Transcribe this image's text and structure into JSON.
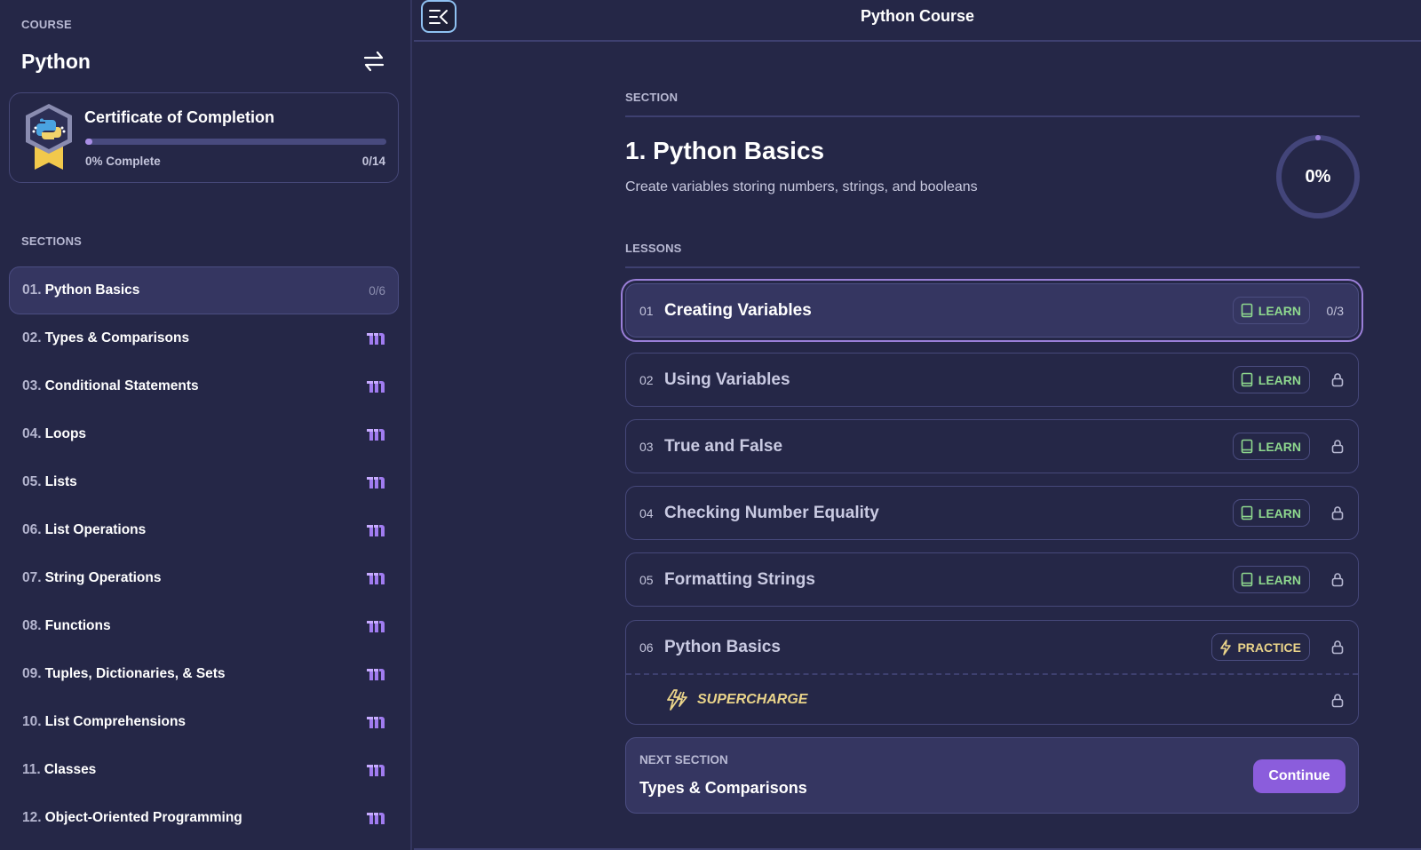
{
  "sidebar": {
    "course_label": "COURSE",
    "course_title": "Python",
    "swap_icon": "swap-arrows-icon",
    "certificate": {
      "title": "Certificate of Completion",
      "progress_percent": 0,
      "progress_text": "0% Complete",
      "count": "0/14",
      "badge_icon": "python-badge-icon"
    },
    "sections_label": "SECTIONS",
    "sections": [
      {
        "num": "01.",
        "name": "Python Basics",
        "count": "0/6",
        "active": true
      },
      {
        "num": "02.",
        "name": "Types & Comparisons",
        "icon": "m-logo-icon"
      },
      {
        "num": "03.",
        "name": "Conditional Statements",
        "icon": "m-logo-icon"
      },
      {
        "num": "04.",
        "name": "Loops",
        "icon": "m-logo-icon"
      },
      {
        "num": "05.",
        "name": "Lists",
        "icon": "m-logo-icon"
      },
      {
        "num": "06.",
        "name": "List Operations",
        "icon": "m-logo-icon"
      },
      {
        "num": "07.",
        "name": "String Operations",
        "icon": "m-logo-icon"
      },
      {
        "num": "08.",
        "name": "Functions",
        "icon": "m-logo-icon"
      },
      {
        "num": "09.",
        "name": "Tuples, Dictionaries, & Sets",
        "icon": "m-logo-icon"
      },
      {
        "num": "10.",
        "name": "List Comprehensions",
        "icon": "m-logo-icon"
      },
      {
        "num": "11.",
        "name": "Classes",
        "icon": "m-logo-icon"
      },
      {
        "num": "12.",
        "name": "Object-Oriented Programming",
        "icon": "m-logo-icon"
      }
    ]
  },
  "header": {
    "menu_icon": "collapse-sidebar-icon",
    "title": "Python Course"
  },
  "main": {
    "section_label": "SECTION",
    "section_title": "1. Python Basics",
    "section_desc": "Create variables storing numbers, strings, and booleans",
    "section_progress_percent": 0,
    "section_progress_text": "0%",
    "lessons_label": "LESSONS",
    "lessons": [
      {
        "num": "01",
        "title": "Creating Variables",
        "tag": "LEARN",
        "right": "0/3",
        "active": true
      },
      {
        "num": "02",
        "title": "Using Variables",
        "tag": "LEARN",
        "locked": true
      },
      {
        "num": "03",
        "title": "True and False",
        "tag": "LEARN",
        "locked": true
      },
      {
        "num": "04",
        "title": "Checking Number Equality",
        "tag": "LEARN",
        "locked": true
      },
      {
        "num": "05",
        "title": "Formatting Strings",
        "tag": "LEARN",
        "locked": true
      },
      {
        "num": "06",
        "title": "Python Basics",
        "tag": "PRACTICE",
        "locked": true
      }
    ],
    "supercharge_label": "SUPERCHARGE",
    "next_section": {
      "label": "NEXT SECTION",
      "title": "Types & Comparisons",
      "button": "Continue"
    }
  },
  "colors": {
    "background": "#252747",
    "accent_purple": "#8b5ddc",
    "learn_green": "#8ed88e",
    "practice_yellow": "#ead48a"
  }
}
